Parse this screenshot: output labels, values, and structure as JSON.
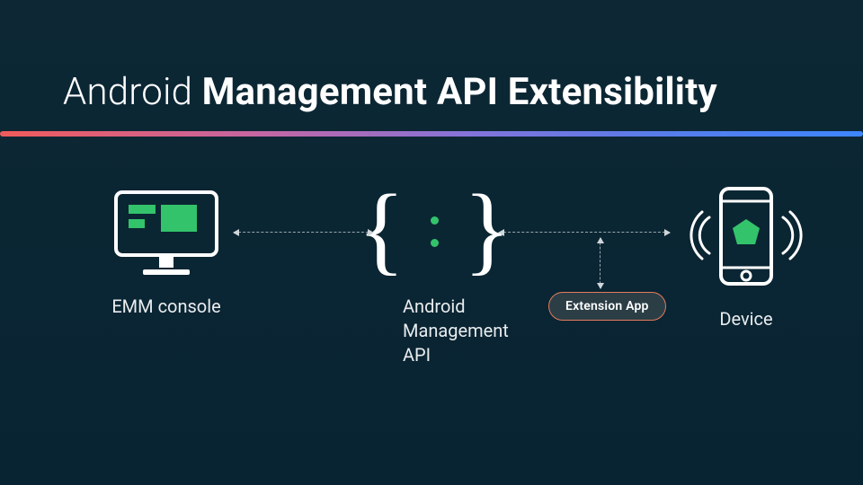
{
  "title": {
    "light": "Android ",
    "bold": "Management API Extensibility"
  },
  "nodes": {
    "emm": {
      "label": "EMM console"
    },
    "api": {
      "label": "Android\nManagement\nAPI"
    },
    "device": {
      "label": "Device"
    }
  },
  "pill": {
    "label": "Extension App"
  },
  "colors": {
    "accent_green": "#33c36b",
    "pill_border": "#e37b5c"
  }
}
